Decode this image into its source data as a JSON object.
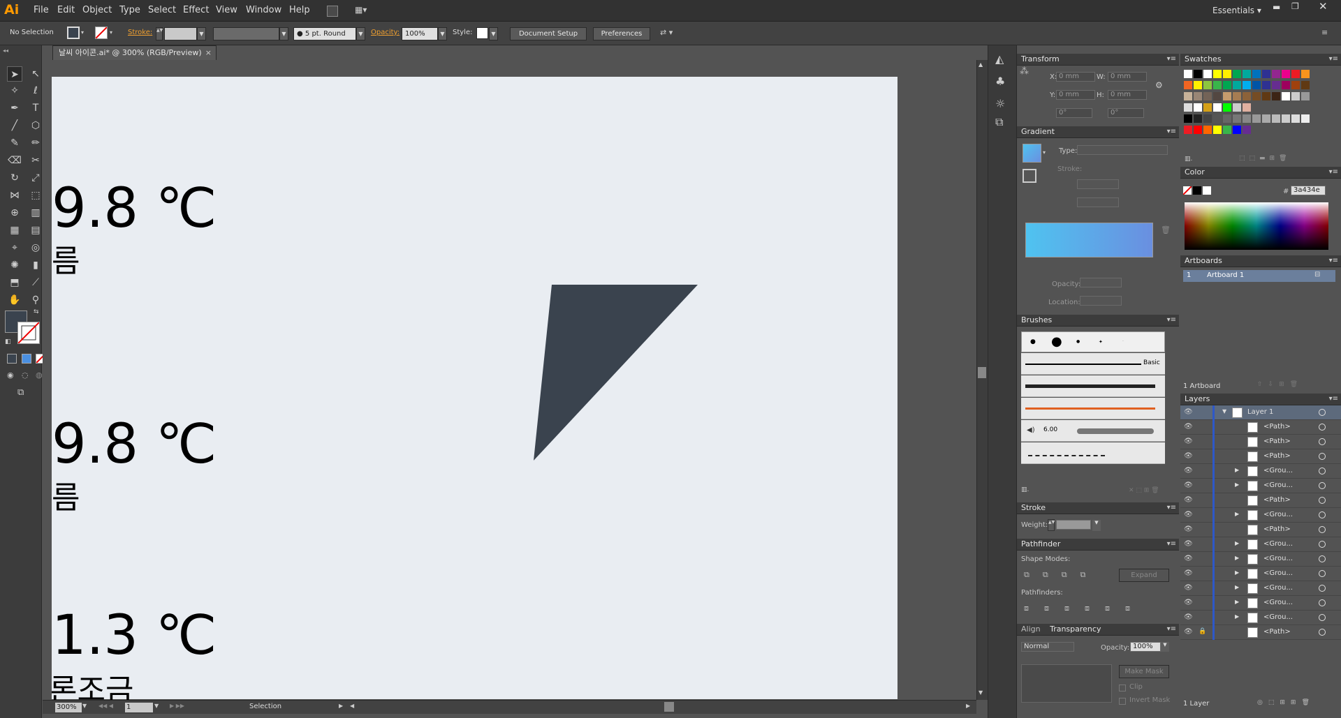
{
  "app": {
    "logo": "Ai",
    "menus": [
      "File",
      "Edit",
      "Object",
      "Type",
      "Select",
      "Effect",
      "View",
      "Window",
      "Help"
    ],
    "workspace": "Essentials"
  },
  "control": {
    "selection": "No Selection",
    "stroke_label": "Stroke:",
    "brush": "5 pt. Round",
    "opacity_label": "Opacity:",
    "opacity": "100%",
    "style_label": "Style:",
    "doc_setup": "Document Setup",
    "preferences": "Preferences"
  },
  "doc": {
    "tab": "날씨 아이콘.ai* @ 300% (RGB/Preview)",
    "zoom": "300%",
    "page": "1",
    "status": "Selection"
  },
  "artboard": {
    "texts": [
      {
        "temp": "9.8 ℃",
        "sub": "름"
      },
      {
        "temp": "9.8 ℃",
        "sub": "름"
      },
      {
        "temp": "1.3 ℃",
        "sub": "론조금"
      }
    ],
    "shape_color": "#3a434e",
    "bg": "#e9edf2"
  },
  "transform": {
    "title": "Transform",
    "x_label": "X:",
    "x": "0 mm",
    "y_label": "Y:",
    "y": "0 mm",
    "w_label": "W:",
    "w": "0 mm",
    "h_label": "H:",
    "h": "0 mm",
    "rot": "0°",
    "shear": "0°"
  },
  "gradient": {
    "title": "Gradient",
    "type_label": "Type:",
    "stroke_label": "Stroke:",
    "opacity_label": "Opacity:",
    "location_label": "Location:",
    "start": "#4fc3f0",
    "end": "#6a8fe0"
  },
  "brushes": {
    "title": "Brushes",
    "basic": "Basic",
    "size": "6.00"
  },
  "stroke": {
    "title": "Stroke",
    "weight_label": "Weight:"
  },
  "pathfinder": {
    "title": "Pathfinder",
    "shape_modes": "Shape Modes:",
    "pathfinders": "Pathfinders:",
    "expand": "Expand"
  },
  "transparency": {
    "align_tab": "Align",
    "title": "Transparency",
    "mode": "Normal",
    "opacity_label": "Opacity:",
    "opacity": "100%",
    "make_mask": "Make Mask",
    "clip": "Clip",
    "invert": "Invert Mask"
  },
  "swatches": {
    "title": "Swatches"
  },
  "color": {
    "title": "Color",
    "hex_label": "#",
    "hex": "3a434e"
  },
  "artboards": {
    "title": "Artboards",
    "rows": [
      {
        "num": "1",
        "name": "Artboard 1"
      }
    ],
    "count": "1 Artboard"
  },
  "layers": {
    "title": "Layers",
    "count": "1 Layer",
    "rows": [
      {
        "name": "Layer 1",
        "expand": true,
        "top": true
      },
      {
        "name": "<Path>"
      },
      {
        "name": "<Path>"
      },
      {
        "name": "<Path>"
      },
      {
        "name": "<Grou...",
        "expand": true
      },
      {
        "name": "<Grou...",
        "expand": true
      },
      {
        "name": "<Path>"
      },
      {
        "name": "<Grou...",
        "expand": true
      },
      {
        "name": "<Path>"
      },
      {
        "name": "<Grou...",
        "expand": true
      },
      {
        "name": "<Grou...",
        "expand": true
      },
      {
        "name": "<Grou...",
        "expand": true
      },
      {
        "name": "<Grou...",
        "expand": true
      },
      {
        "name": "<Grou...",
        "expand": true
      },
      {
        "name": "<Grou...",
        "expand": true
      },
      {
        "name": "<Path>",
        "locked": true
      }
    ]
  }
}
